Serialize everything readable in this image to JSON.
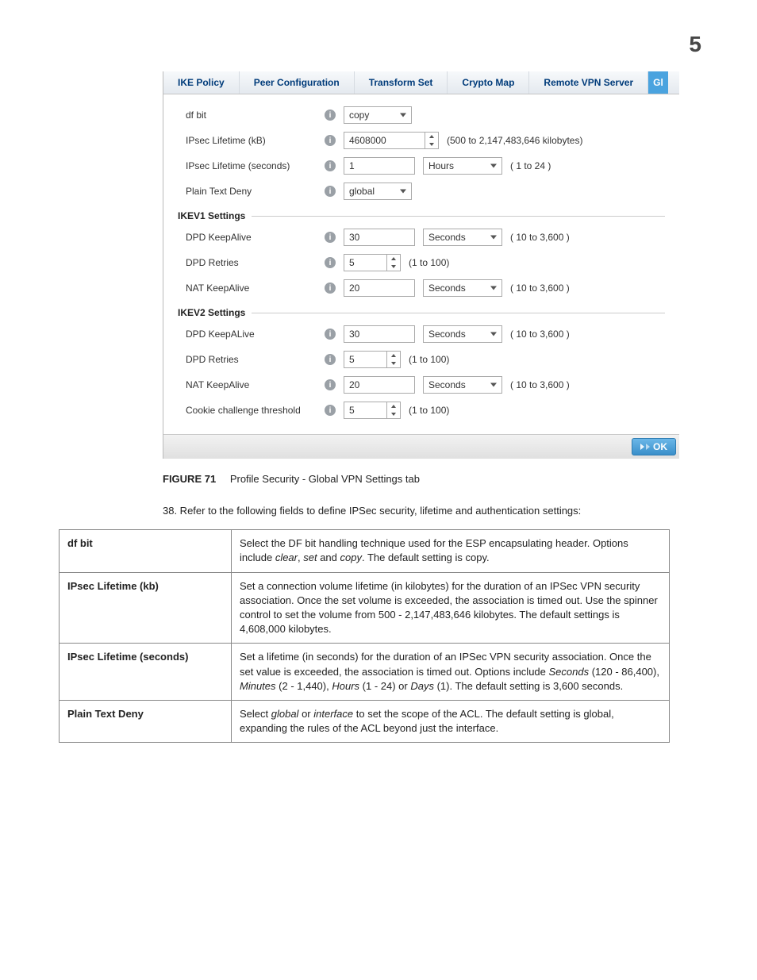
{
  "page_number": "5",
  "tabs": {
    "t1": "IKE Policy",
    "t2": "Peer Configuration",
    "t3": "Transform Set",
    "t4": "Crypto Map",
    "t5": "Remote VPN Server",
    "t6": "Gl"
  },
  "rows": {
    "dfbit": {
      "label": "df bit",
      "value": "copy"
    },
    "lifekb": {
      "label": "IPsec Lifetime (kB)",
      "value": "4608000",
      "hint": "(500 to 2,147,483,646 kilobytes)"
    },
    "lifesec": {
      "label": "IPsec Lifetime (seconds)",
      "value": "1",
      "unit": "Hours",
      "hint": "( 1 to 24 )"
    },
    "ptd": {
      "label": "Plain Text Deny",
      "value": "global"
    }
  },
  "sec1": "IKEV1 Settings",
  "ikev1": {
    "dpdka": {
      "label": "DPD KeepAlive",
      "value": "30",
      "unit": "Seconds",
      "hint": "( 10 to 3,600 )"
    },
    "dpdr": {
      "label": "DPD Retries",
      "value": "5",
      "hint": "(1 to 100)"
    },
    "natka": {
      "label": "NAT KeepAlive",
      "value": "20",
      "unit": "Seconds",
      "hint": "( 10 to 3,600 )"
    }
  },
  "sec2": "IKEV2 Settings",
  "ikev2": {
    "dpdka": {
      "label": "DPD KeepALive",
      "value": "30",
      "unit": "Seconds",
      "hint": "( 10 to 3,600 )"
    },
    "dpdr": {
      "label": "DPD Retries",
      "value": "5",
      "hint": "(1 to 100)"
    },
    "natka": {
      "label": "NAT KeepAlive",
      "value": "20",
      "unit": "Seconds",
      "hint": "( 10 to 3,600 )"
    },
    "cct": {
      "label": "Cookie challenge threshold",
      "value": "5",
      "hint": "(1 to 100)"
    }
  },
  "ok": "OK",
  "figure": {
    "label": "FIGURE 71",
    "caption": "Profile Security - Global VPN Settings tab"
  },
  "step": "38. Refer to the following fields to define IPSec security, lifetime and authentication settings:",
  "table": {
    "r1": {
      "name": "df bit",
      "pre": "Select the DF bit handling technique used for the ESP encapsulating header. Options include ",
      "i1": "clear",
      "c1": ", ",
      "i2": "set",
      "c2": " and ",
      "i3": "copy",
      "post": ". The default setting is copy."
    },
    "r2": {
      "name": "IPsec Lifetime (kb)",
      "desc": "Set a connection volume lifetime (in kilobytes) for the duration of an IPSec VPN security association. Once the set volume is exceeded, the association is timed out. Use the spinner control to set the volume from 500 - 2,147,483,646 kilobytes. The default settings is 4,608,000 kilobytes."
    },
    "r3": {
      "name": "IPsec Lifetime (seconds)",
      "pre": "Set a lifetime (in seconds) for the duration of an IPSec VPN security association. Once the set value is exceeded, the association is timed out. Options include ",
      "i1": "Seconds",
      "c1": " (120 - 86,400), ",
      "i2": "Minutes",
      "c2": " (2 - 1,440), ",
      "i3": "Hours",
      "c3": " (1 - 24) or ",
      "i4": "Days",
      "post": " (1). The default setting is 3,600 seconds."
    },
    "r4": {
      "name": "Plain Text Deny",
      "pre": "Select ",
      "i1": "global",
      "c1": " or ",
      "i2": "interface",
      "post": " to set the scope of the ACL. The default setting is global, expanding the rules of the ACL beyond just the interface."
    }
  }
}
